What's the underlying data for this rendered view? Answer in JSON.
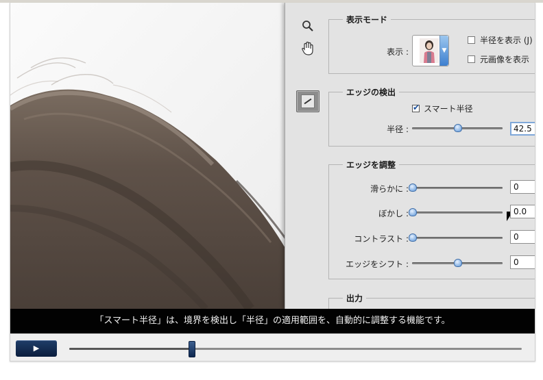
{
  "panel": {
    "view_mode": {
      "title": "表示モード",
      "view_label": "表示 :",
      "show_radius_label": "半径を表示 (J)",
      "show_original_label": "元画像を表示",
      "show_radius_checked": false,
      "show_original_checked": false
    },
    "edge_detection": {
      "title": "エッジの検出",
      "smart_radius_label": "スマート半径",
      "smart_radius_checked": true,
      "radius_label": "半径 :",
      "radius_value": "42.5",
      "radius_level": 0.5
    },
    "adjust_edge": {
      "title": "エッジを調整",
      "rows": [
        {
          "label": "滑らかに :",
          "value": "0",
          "level": 0.0
        },
        {
          "label": "ぼかし :",
          "value": "0.0",
          "level": 0.0
        },
        {
          "label": "コントラスト :",
          "value": "0",
          "level": 0.0
        },
        {
          "label": "エッジをシフト :",
          "value": "0",
          "level": 0.5
        }
      ]
    },
    "output": {
      "title": "出力"
    },
    "tools": [
      "zoom-icon",
      "hand-icon",
      "refine-radius-tool-icon"
    ]
  },
  "caption": "「スマート半径」は、境界を検出し「半径」の適用範囲を、自動的に調整する機能です。",
  "player": {
    "play_icon": "▶",
    "progress": 0.27
  },
  "colors": {
    "panel_bg": "#e3e3e3",
    "caption_bg": "#020202",
    "play_button": "#0a1d3d",
    "knob_blue": "#5c95d6"
  }
}
